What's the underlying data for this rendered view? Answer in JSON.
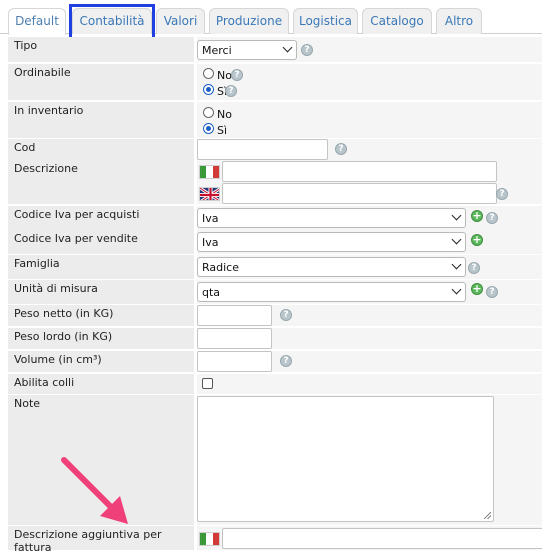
{
  "tabs": [
    {
      "label": "Default",
      "active": true
    },
    {
      "label": "Contabilità",
      "active": false
    },
    {
      "label": "Valori",
      "active": false
    },
    {
      "label": "Produzione",
      "active": false
    },
    {
      "label": "Logistica",
      "active": false
    },
    {
      "label": "Catalogo",
      "active": false
    },
    {
      "label": "Altro",
      "active": false
    }
  ],
  "form": {
    "tipo": {
      "label": "Tipo",
      "value": "Merci"
    },
    "ordinabile": {
      "label": "Ordinabile",
      "opt_no": "No",
      "opt_si": "Sì",
      "selected": "Sì"
    },
    "inventario": {
      "label": "In inventario",
      "opt_no": "No",
      "opt_si": "Sì",
      "selected": "Sì"
    },
    "cod": {
      "label": "Cod",
      "value": ""
    },
    "descrizione": {
      "label": "Descrizione",
      "value_it": "",
      "value_en": ""
    },
    "iva_acquisti": {
      "label": "Codice Iva per acquisti",
      "value": "Iva"
    },
    "iva_vendite": {
      "label": "Codice Iva per vendite",
      "value": "Iva"
    },
    "famiglia": {
      "label": "Famiglia",
      "value": "Radice"
    },
    "unita": {
      "label": "Unità di misura",
      "value": "qta"
    },
    "peso_netto": {
      "label": "Peso netto (in KG)",
      "value": ""
    },
    "peso_lordo": {
      "label": "Peso lordo (in KG)",
      "value": ""
    },
    "volume": {
      "label": "Volume (in cm³)",
      "value": ""
    },
    "colli": {
      "label": "Abilita colli",
      "checked": false
    },
    "note": {
      "label": "Note",
      "value": ""
    },
    "desc_fattura": {
      "label": "Descrizione aggiuntiva per fattura",
      "value": ""
    }
  },
  "icons": {
    "help": "?",
    "add": "+"
  },
  "colors": {
    "tab_highlight": "#1f3fe0",
    "arrow": "#f0407a",
    "link": "#3a78b8"
  }
}
